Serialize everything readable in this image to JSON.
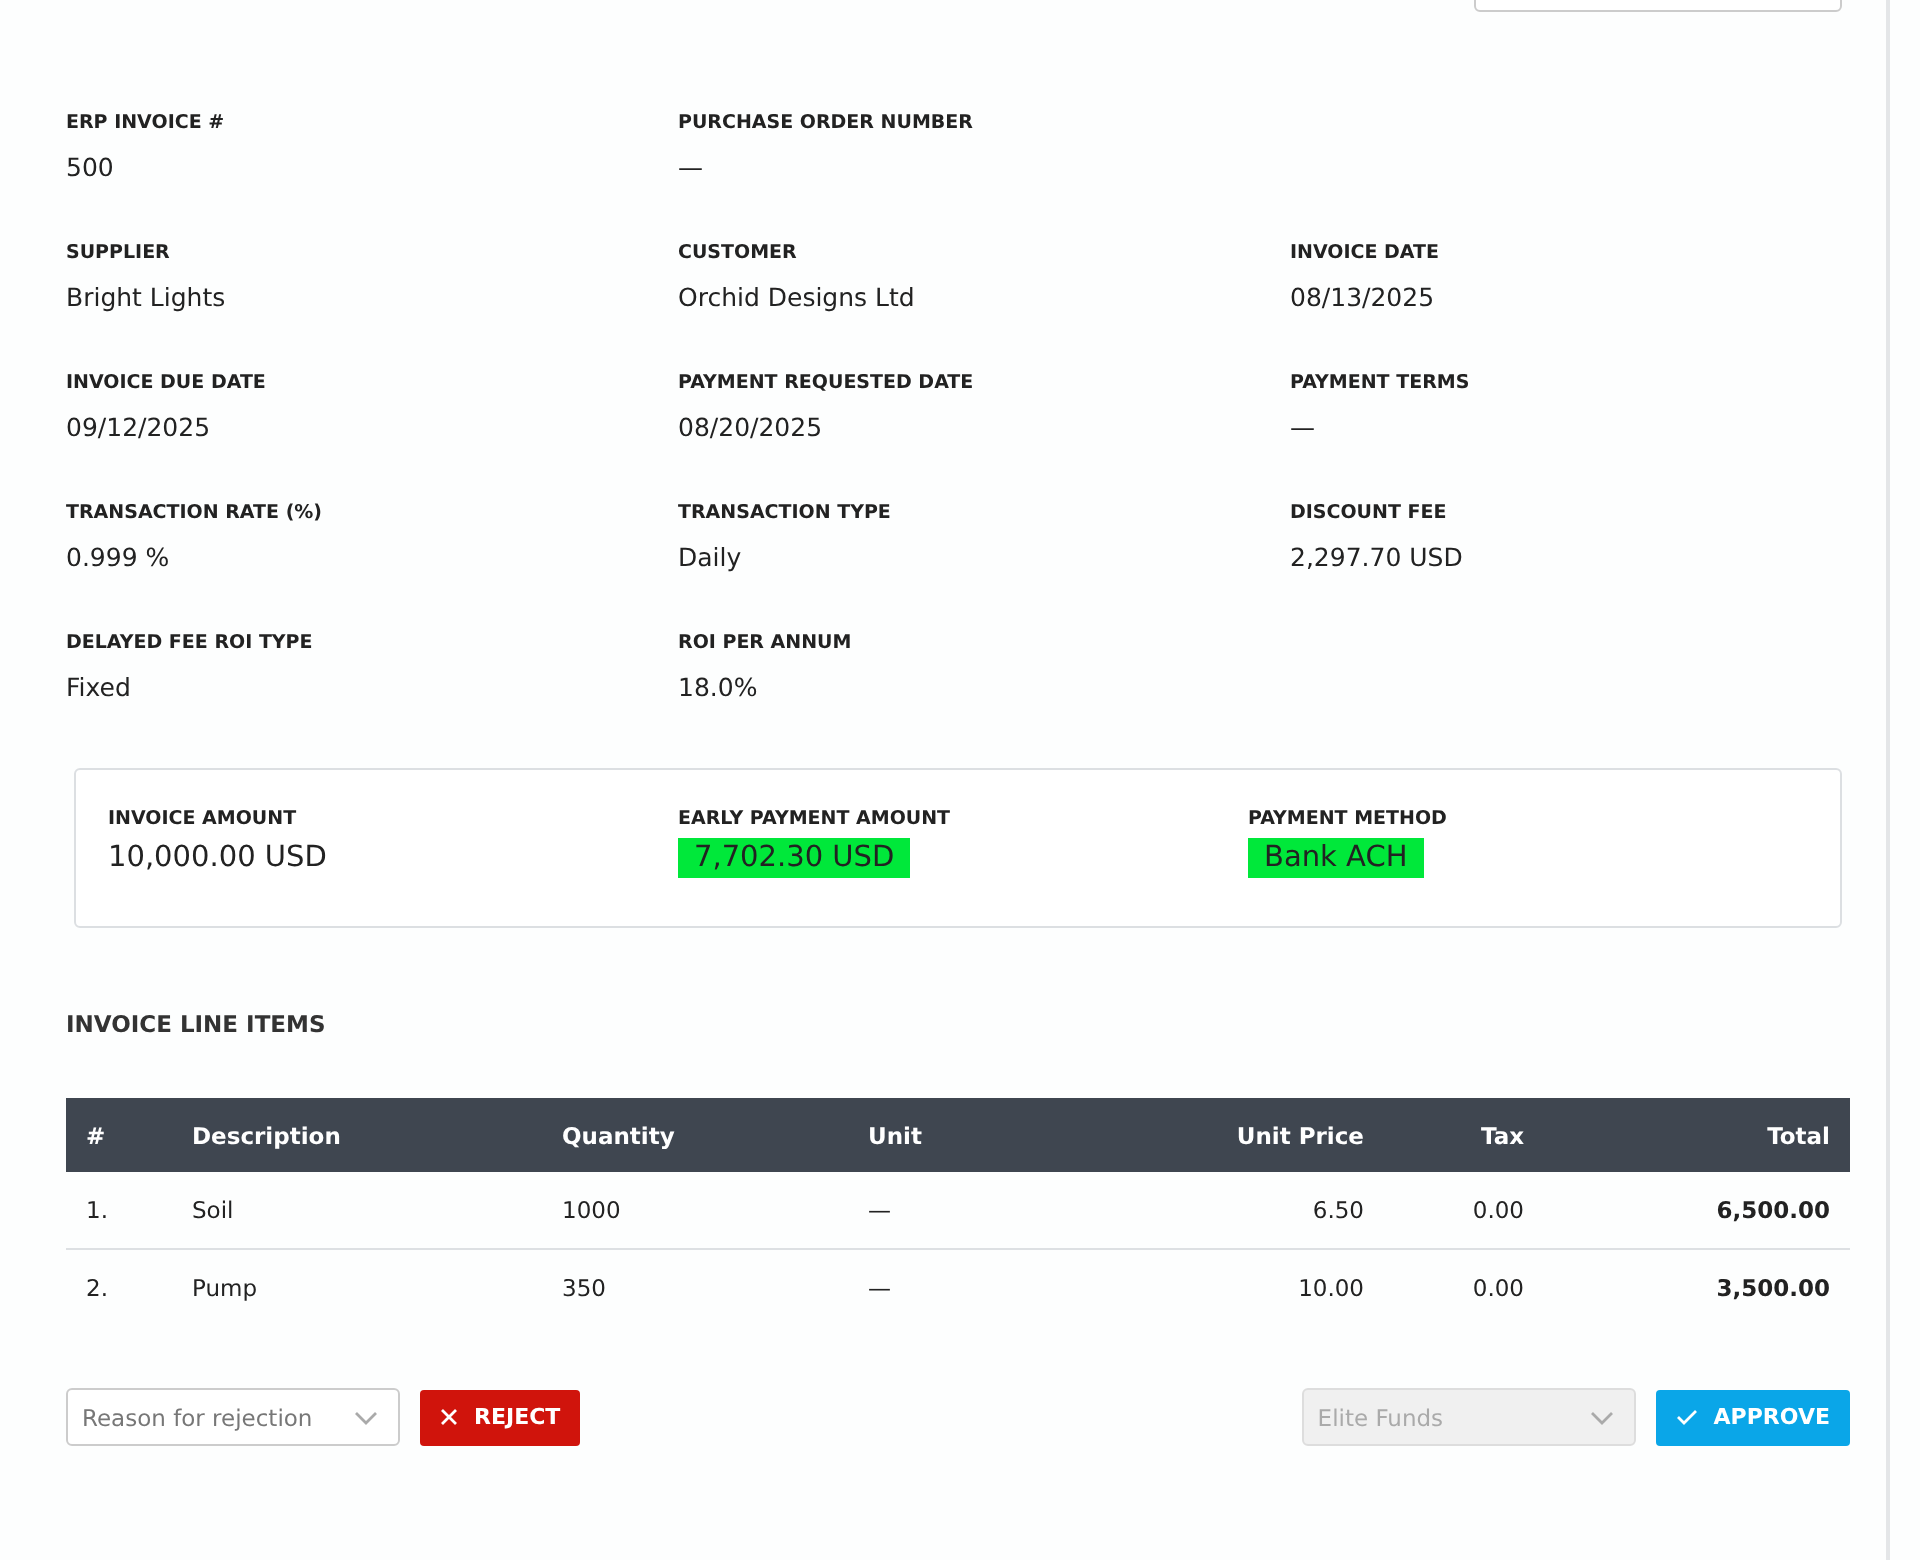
{
  "fields": [
    [
      {
        "label": "ERP INVOICE #",
        "value": "500"
      },
      {
        "label": "PURCHASE ORDER NUMBER",
        "value": "—"
      }
    ],
    [
      {
        "label": "SUPPLIER",
        "value": "Bright Lights"
      },
      {
        "label": "CUSTOMER",
        "value": "Orchid Designs Ltd"
      },
      {
        "label": "INVOICE DATE",
        "value": "08/13/2025"
      }
    ],
    [
      {
        "label": "INVOICE DUE DATE",
        "value": "09/12/2025"
      },
      {
        "label": "PAYMENT REQUESTED DATE",
        "value": "08/20/2025"
      },
      {
        "label": "PAYMENT TERMS",
        "value": "—"
      }
    ],
    [
      {
        "label": "TRANSACTION RATE (%)",
        "value": "0.999 %"
      },
      {
        "label": "TRANSACTION TYPE",
        "value": "Daily"
      },
      {
        "label": "DISCOUNT FEE",
        "value": "2,297.70 USD"
      }
    ],
    [
      {
        "label": "DELAYED FEE ROI TYPE",
        "value": "Fixed"
      },
      {
        "label": "ROI PER ANNUM",
        "value": "18.0%"
      }
    ]
  ],
  "summary": [
    {
      "label": "INVOICE AMOUNT",
      "value": "10,000.00 USD",
      "highlighted": false
    },
    {
      "label": "EARLY PAYMENT AMOUNT",
      "value": "7,702.30 USD",
      "highlighted": true
    },
    {
      "label": "PAYMENT METHOD",
      "value": "Bank ACH",
      "highlighted": true
    }
  ],
  "line_items": {
    "title": "INVOICE LINE ITEMS",
    "columns": [
      "#",
      "Description",
      "Quantity",
      "Unit",
      "Unit Price",
      "Tax",
      "Total"
    ],
    "rows": [
      [
        "1.",
        "Soil",
        "1000",
        "—",
        "6.50",
        "0.00",
        "6,500.00"
      ],
      [
        "2.",
        "Pump",
        "350",
        "—",
        "10.00",
        "0.00",
        "3,500.00"
      ]
    ]
  },
  "actions": {
    "rejection_reason": {
      "placeholder": "Reason for rejection"
    },
    "reject_button": "REJECT",
    "funder": {
      "value": "Elite Funds",
      "disabled": true
    },
    "approve_button": "APPROVE"
  }
}
